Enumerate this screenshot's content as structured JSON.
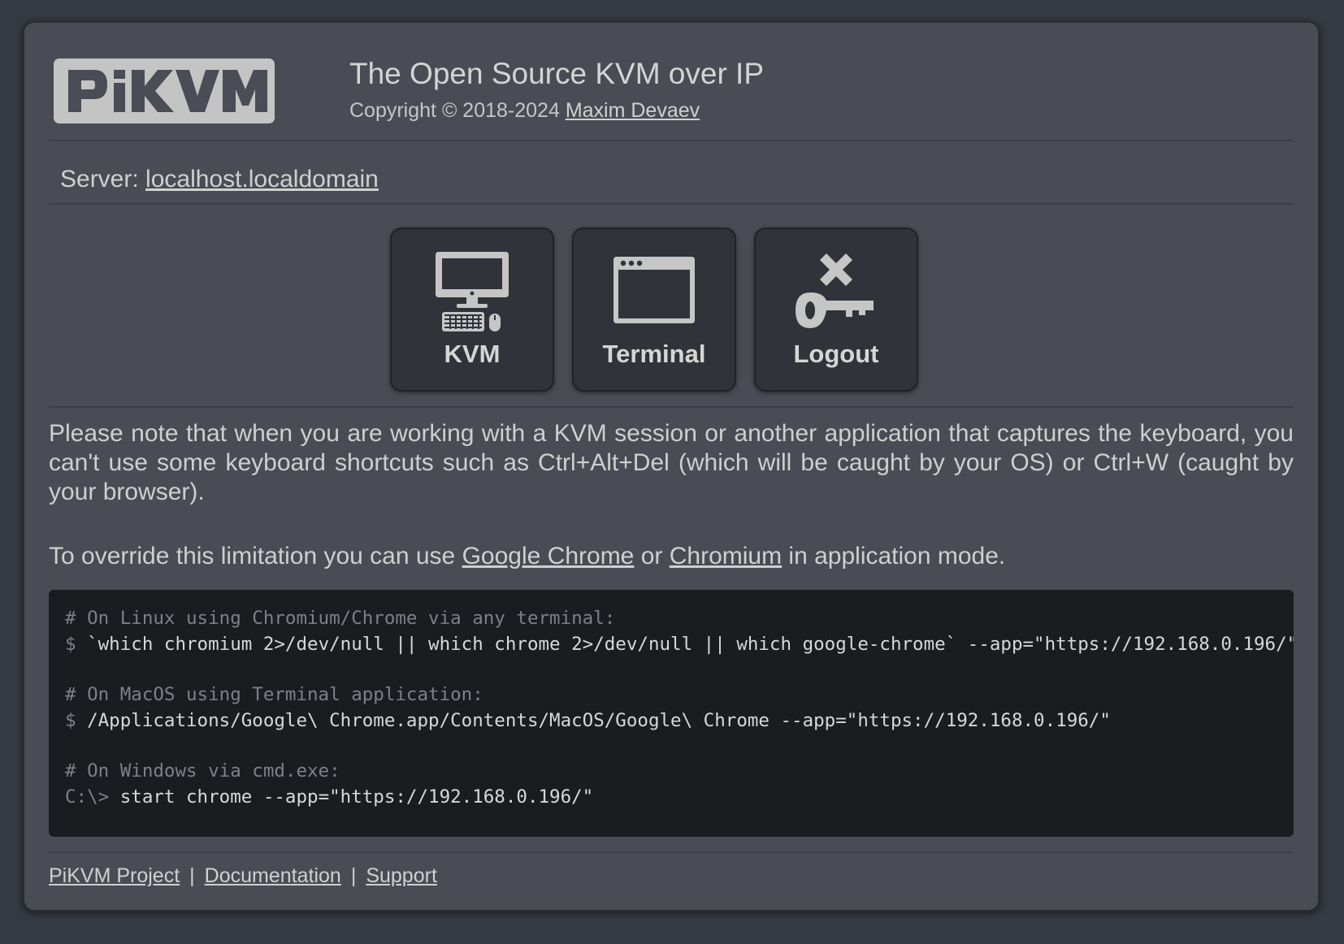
{
  "header": {
    "logo_text": "PiKVM",
    "title": "The Open Source KVM over IP",
    "copyright_prefix": "Copyright © 2018-2024 ",
    "author_link": "Maxim Devaev"
  },
  "server": {
    "label": "Server: ",
    "hostname": "localhost.localdomain"
  },
  "apps": [
    {
      "label": "KVM",
      "icon": "monitor-keyboard-icon"
    },
    {
      "label": "Terminal",
      "icon": "terminal-window-icon"
    },
    {
      "label": "Logout",
      "icon": "key-logout-icon"
    }
  ],
  "note": {
    "text": "Please note that when you are working with a KVM session or another application that captures the keyboard, you can't use some keyboard shortcuts such as Ctrl+Alt+Del (which will be caught by your OS) or Ctrl+W (caught by your browser).",
    "override_prefix": "To override this limitation you can use ",
    "chrome_link": "Google Chrome",
    "or_text": " or ",
    "chromium_link": "Chromium",
    "override_suffix": " in application mode."
  },
  "code": {
    "linux_comment": "# On Linux using Chromium/Chrome via any terminal:",
    "linux_prompt": "$ ",
    "linux_cmd": "`which chromium 2>/dev/null || which chrome 2>/dev/null || which google-chrome` --app=\"https://192.168.0.196/\"",
    "macos_comment": "# On MacOS using Terminal application:",
    "macos_prompt": "$ ",
    "macos_cmd": "/Applications/Google\\ Chrome.app/Contents/MacOS/Google\\ Chrome --app=\"https://192.168.0.196/\"",
    "windows_comment": "# On Windows via cmd.exe:",
    "windows_prompt": "C:\\> ",
    "windows_cmd": "start chrome --app=\"https://192.168.0.196/\""
  },
  "footer": {
    "links": [
      "PiKVM Project",
      "Documentation",
      "Support"
    ],
    "separator": "|"
  },
  "colors": {
    "page_bg": "#363a42",
    "window_bg": "#494c54",
    "button_bg": "#30333a",
    "code_bg": "#1b1c20",
    "text": "#cfcfcf",
    "comment": "#7e8087"
  }
}
